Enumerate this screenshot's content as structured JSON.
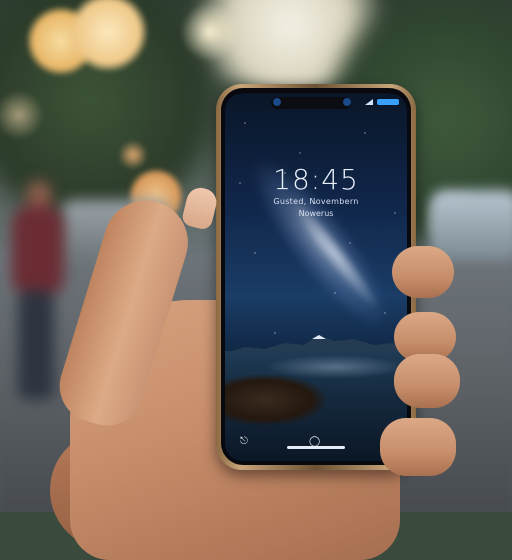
{
  "scene": {
    "description_colors": {
      "phone_frame": "#c9a57a",
      "screen_sky_top": "#0a1628",
      "screen_sky_mid": "#1a3c66",
      "battery": "#3aa0ff",
      "text": "#e8eef8"
    }
  },
  "lock_screen": {
    "time": "18:45",
    "date_line1": "Gusted, Novembern",
    "date_line2": "Nowerus"
  },
  "icons": {
    "bottom_left": "flashlight-icon",
    "bottom_center": "fingerprint-icon",
    "bottom_right": "camera-icon"
  }
}
